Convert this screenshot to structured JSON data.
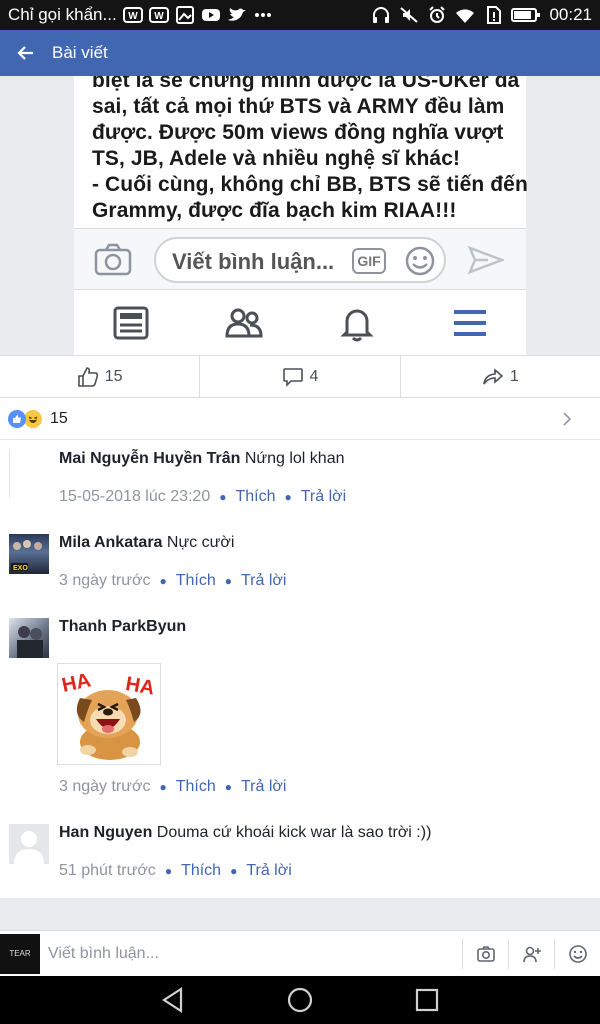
{
  "status_bar": {
    "notification_text": "Chỉ gọi khẩn...",
    "time": "00:21",
    "left_icons": [
      "notification-icon",
      "notification-icon",
      "image-icon",
      "youtube-icon",
      "twitter-icon",
      "more-icon"
    ],
    "right_icons": [
      "headphones-icon",
      "mute-icon",
      "alarm-icon",
      "wifi-icon",
      "sim-alert-icon",
      "battery-icon"
    ]
  },
  "header": {
    "title": "Bài viết",
    "back_icon": "back-arrow-icon",
    "color": "#4267b2"
  },
  "post_image": {
    "lines": [
      "biệt là sẽ chứng minh được là US-UKer đã",
      "sai, tất cả mọi thứ BTS và ARMY đều làm",
      "được. Được 50m views đồng nghĩa vượt",
      "TS, JB, Adele và nhiều nghệ sĩ khác!",
      "- Cuối cùng, không chỉ BB, BTS sẽ tiến đến",
      "Grammy, được đĩa bạch kim RIAA!!!"
    ],
    "comment_placeholder": "Viết bình luận...",
    "gif_label": "GIF"
  },
  "actions": {
    "likes": "15",
    "comments": "4",
    "shares": "1"
  },
  "reactions": {
    "count": "15"
  },
  "comments": [
    {
      "name": "Mai Nguyễn Huyền Trân",
      "text": "Nứng lol khan",
      "time": "15-05-2018 lúc 23:20",
      "like": "Thích",
      "reply": "Trả lời"
    },
    {
      "name": "Mila Ankatara",
      "text": "Nực cười",
      "time": "3 ngày trước",
      "like": "Thích",
      "reply": "Trả lời"
    },
    {
      "name": "Thanh ParkByun",
      "text": "",
      "time": "3 ngày trước",
      "like": "Thích",
      "reply": "Trả lời",
      "sticker": "HA HA"
    },
    {
      "name": "Han Nguyen",
      "text": "Douma cứ khoái kick war là sao trời :))",
      "time": "51 phút trước",
      "like": "Thích",
      "reply": "Trả lời"
    }
  ],
  "composer": {
    "placeholder": "Viết bình luận...",
    "avatar_text": "TEAR"
  }
}
